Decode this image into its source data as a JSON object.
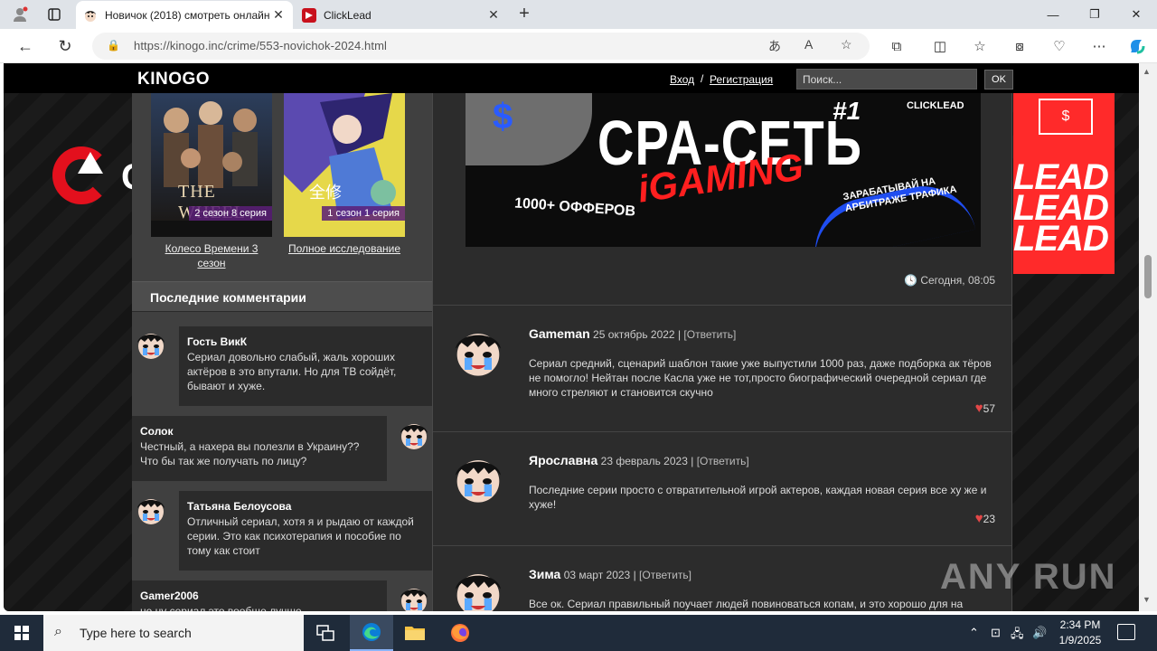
{
  "browser": {
    "tabs": [
      {
        "title": "Новичок (2018) смотреть онлайн",
        "active": true
      },
      {
        "title": "ClickLead",
        "active": false
      }
    ],
    "url": "https://kinogo.inc/crime/553-novichok-2024.html"
  },
  "site": {
    "logo": "KINOGO",
    "login": "Вход",
    "separator": "/",
    "register": "Регистрация",
    "search_placeholder": "Поиск...",
    "search_button": "OK"
  },
  "posters": [
    {
      "badge": "2 сезон 8 серия",
      "title": "Колесо Времени 3 сезон",
      "poster_text": "THE WHEEL"
    },
    {
      "badge": "1 сезон 1 серия",
      "title": "Полное исследование",
      "poster_text": "全修"
    }
  ],
  "recent_comments": {
    "heading": "Последние комментарии",
    "items": [
      {
        "name": "Гость ВикК",
        "text": "Сериал довольно слабый, жаль хороших актёров в это впутали. Но для ТВ сойдёт, бывают и хуже."
      },
      {
        "name": "Солок",
        "text": "Честный, а нахера вы полезли в Украину?? Что бы так же получать по лицу?"
      },
      {
        "name": "Татьяна Белоусова",
        "text": "Отличный сериал, хотя я и рыдаю от каждой серии. Это как психотерапия и пособие по тому как стоит"
      },
      {
        "name": "Gamer2006",
        "text": "не ну сериал это вообще лучше..."
      }
    ]
  },
  "banner": {
    "title": "CPA-СЕТЬ",
    "number": "#1",
    "brand": "CLICKLEAD",
    "subtitle": "iGAMING",
    "offers": "1000+ ОФФЕРОВ",
    "slogan": "ЗАРАБАТЫВАЙ НА АРБИТРАЖЕ ТРАФИКА",
    "dollar": "$"
  },
  "post_date": "Сегодня, 08:05",
  "comments": [
    {
      "user": "Gameman",
      "date": "25 октябрь 2022",
      "sep": "|",
      "reply": "[Ответить]",
      "text": "Сериал средний, сценарий шаблон такие уже выпустили 1000 раз, даже подборка ак тёров не помогло! Нейтан после Касла уже не тот,просто биографический очередной сериал где много стреляют и становится скучно",
      "likes": "57"
    },
    {
      "user": "Ярославна",
      "date": "23 февраль 2023",
      "sep": "|",
      "reply": "[Ответить]",
      "text": "Последние серии просто с отвратительной игрой актеров, каждая новая серия все ху же и хуже!",
      "likes": "23"
    },
    {
      "user": "Зима",
      "date": "03 март 2023",
      "sep": "|",
      "reply": "[Ответить]",
      "text": "Все ок. Сериал правильный поучает людей повиноваться копам, и это хорошо для на",
      "likes": ""
    }
  ],
  "right_banner": {
    "text": "LEAD LEAD LEAD",
    "icon": "$"
  },
  "watermark": "ANY RUN",
  "taskbar": {
    "search_placeholder": "Type here to search",
    "time": "2:34 PM",
    "date": "1/9/2025"
  }
}
